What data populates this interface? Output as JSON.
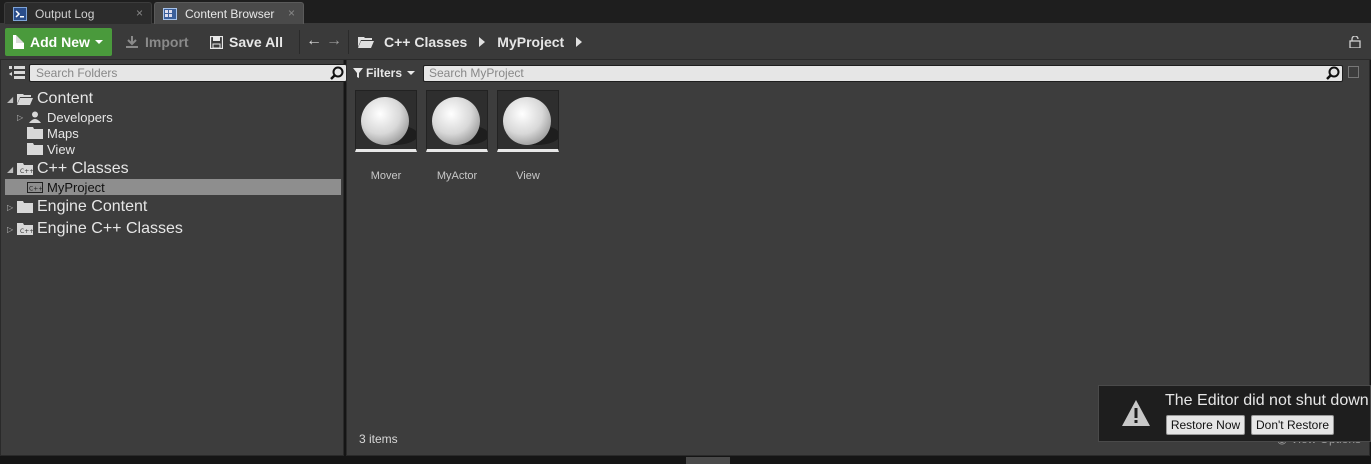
{
  "tabs": [
    {
      "label": "Output Log",
      "icon": "output-log-icon",
      "close": "×"
    },
    {
      "label": "Content Browser",
      "icon": "content-browser-icon",
      "close": "×"
    }
  ],
  "toolbar": {
    "add_new_label": "Add New",
    "import_label": "Import",
    "save_all_label": "Save All",
    "back_icon": "←",
    "forward_icon": "→"
  },
  "breadcrumbs": [
    "C++ Classes",
    "MyProject"
  ],
  "folder_search": {
    "placeholder": "Search Folders"
  },
  "tree": {
    "content": "Content",
    "developers": "Developers",
    "maps": "Maps",
    "view": "View",
    "cpp_classes": "C++ Classes",
    "myproject": "MyProject",
    "engine_content": "Engine Content",
    "engine_cpp_classes": "Engine C++ Classes"
  },
  "asset_search": {
    "filters_label": "Filters",
    "placeholder": "Search MyProject"
  },
  "assets": [
    {
      "label": "Mover"
    },
    {
      "label": "MyActor"
    },
    {
      "label": "View"
    }
  ],
  "status": {
    "item_count": "3 items",
    "view_options": "View Options"
  },
  "notification": {
    "message": "The Editor did not shut down",
    "restore_now": "Restore Now",
    "dont_restore": "Don't Restore"
  },
  "colors": {
    "accent_green": "#4a9a3c",
    "panel_bg": "#3d3d3d",
    "selected_row": "#8e8e8e"
  }
}
